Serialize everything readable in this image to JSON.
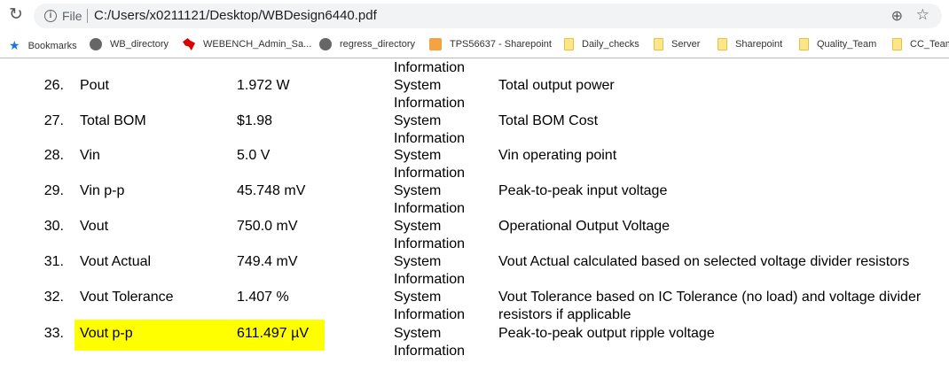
{
  "browser": {
    "file_label": "File",
    "url": "C:/Users/x0211121/Desktop/WBDesign6440.pdf"
  },
  "bookmarks": [
    {
      "label": "Bookmarks",
      "icon": "star-icon"
    },
    {
      "label": "WB_directory",
      "icon": "globe-icon"
    },
    {
      "label": "WEBENCH_Admin_Sa...",
      "icon": "ti-logo-icon"
    },
    {
      "label": "regress_directory",
      "icon": "globe-icon"
    },
    {
      "label": "TPS56637 - Sharepoint",
      "icon": "sharepoint-icon"
    },
    {
      "label": "Daily_checks",
      "icon": "folder-icon"
    },
    {
      "label": "Server",
      "icon": "folder-icon"
    },
    {
      "label": "Sharepoint",
      "icon": "folder-icon"
    },
    {
      "label": "Quality_Team",
      "icon": "folder-icon"
    },
    {
      "label": "CC_Team",
      "icon": "folder-icon"
    }
  ],
  "partial_top": "Information",
  "rows": [
    {
      "num": "26.",
      "name": "Pout",
      "value": "1.972 W",
      "category": "System Information",
      "description": "Total output power"
    },
    {
      "num": "27.",
      "name": "Total BOM",
      "value": "$1.98",
      "category": "System Information",
      "description": "Total BOM Cost"
    },
    {
      "num": "28.",
      "name": "Vin",
      "value": "5.0 V",
      "category": "System Information",
      "description": "Vin operating point"
    },
    {
      "num": "29.",
      "name": "Vin p-p",
      "value": "45.748 mV",
      "category": "System Information",
      "description": "Peak-to-peak input voltage"
    },
    {
      "num": "30.",
      "name": "Vout",
      "value": "750.0 mV",
      "category": "System Information",
      "description": "Operational Output Voltage"
    },
    {
      "num": "31.",
      "name": "Vout Actual",
      "value": "749.4 mV",
      "category": "System Information",
      "description": "Vout Actual calculated based on selected voltage divider resistors"
    },
    {
      "num": "32.",
      "name": "Vout Tolerance",
      "value": "1.407 %",
      "category": "System Information",
      "description": "Vout Tolerance based on IC Tolerance (no load) and voltage divider resistors if applicable"
    },
    {
      "num": "33.",
      "name": "Vout p-p",
      "value": "611.497 µV",
      "category": "System Information",
      "description": "Peak-to-peak output ripple voltage"
    }
  ],
  "highlight_color": "#ffff00"
}
